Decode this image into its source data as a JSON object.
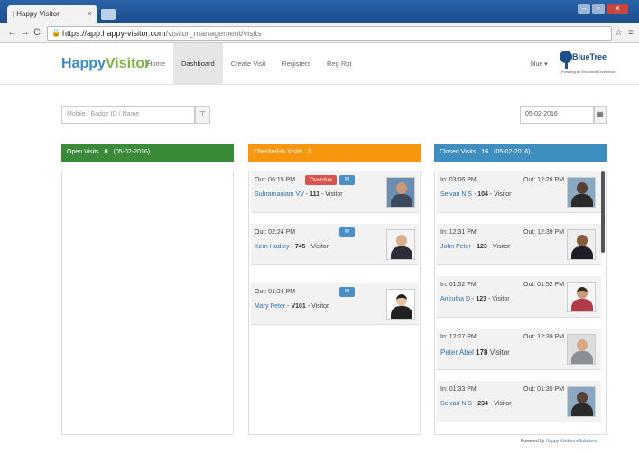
{
  "browser": {
    "tab_title": "| Happy Visitor",
    "tab_close": "×",
    "url_host": "https://app.happy-visitor.com",
    "url_path": "/visitor_management/visits"
  },
  "header": {
    "logo_happy": "Happy",
    "logo_visitor": "Visitor",
    "nav": [
      "Home",
      "Dashboard",
      "Create Visit",
      "Registers",
      "Reg Rpt"
    ],
    "user": "blue ▾",
    "brand": "BlueTree",
    "brand_tagline": "Pursuing an Evolution Excellence"
  },
  "filters": {
    "search_placeholder": "Mobile / Badge ID / Name",
    "date": "05-02-2016"
  },
  "columns": {
    "open": {
      "label": "Open Visits",
      "count": "0",
      "date": "(05-02-2016)",
      "color": "#3a8a3a"
    },
    "checked_in": {
      "label": "Checked-in Visits",
      "count": "3",
      "color": "#f7960f"
    },
    "closed": {
      "label": "Closed Visits",
      "count": "16",
      "date": "(05-02-2016)",
      "color": "#3f8ec0"
    }
  },
  "checked_in_visits": [
    {
      "out": "Out: 06:15 PM",
      "overdue": "Overdue",
      "name": "Subramaniam VV",
      "badge": "111",
      "type": "Visitor"
    },
    {
      "out": "Out: 02:24 PM",
      "name": "Kern Hadley",
      "badge": "745",
      "type": "Visitor"
    },
    {
      "out": "Out: 01:24 PM",
      "name": "Mary Peter",
      "badge": "V101",
      "type": "Visitor"
    }
  ],
  "closed_visits": [
    {
      "in": "In: 03:06 PM",
      "out": "Out: 12:28 PM",
      "name": "Selvan N S",
      "badge": "104",
      "type": "Visitor"
    },
    {
      "in": "In: 12:31 PM",
      "out": "Out: 12:39 PM",
      "name": "John Peter",
      "badge": "123",
      "type": "Visitor"
    },
    {
      "in": "In: 01:52 PM",
      "out": "Out: 01:52 PM",
      "name": "Anirutha D",
      "badge": "123",
      "type": "Visitor"
    },
    {
      "in": "In: 12:27 PM",
      "out": "Out: 12:39 PM",
      "name": "Peter Abel",
      "badge": "178",
      "type": "Visitor"
    },
    {
      "in": "In: 01:33 PM",
      "out": "Out: 01:35 PM",
      "name": "Selvan N S",
      "badge": "234",
      "type": "Visitor"
    }
  ],
  "footer": {
    "powered": "Powered by",
    "company": "Happy Visitors eSolutions"
  }
}
